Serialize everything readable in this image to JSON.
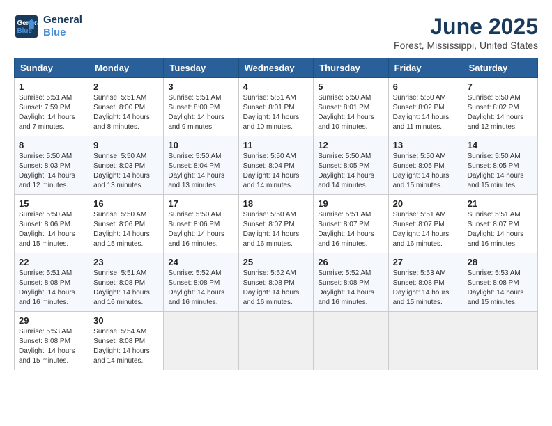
{
  "logo": {
    "line1": "General",
    "line2": "Blue"
  },
  "title": "June 2025",
  "location": "Forest, Mississippi, United States",
  "weekdays": [
    "Sunday",
    "Monday",
    "Tuesday",
    "Wednesday",
    "Thursday",
    "Friday",
    "Saturday"
  ],
  "weeks": [
    [
      {
        "day": "1",
        "sunrise": "5:51 AM",
        "sunset": "7:59 PM",
        "daylight": "14 hours and 7 minutes."
      },
      {
        "day": "2",
        "sunrise": "5:51 AM",
        "sunset": "8:00 PM",
        "daylight": "14 hours and 8 minutes."
      },
      {
        "day": "3",
        "sunrise": "5:51 AM",
        "sunset": "8:00 PM",
        "daylight": "14 hours and 9 minutes."
      },
      {
        "day": "4",
        "sunrise": "5:51 AM",
        "sunset": "8:01 PM",
        "daylight": "14 hours and 10 minutes."
      },
      {
        "day": "5",
        "sunrise": "5:50 AM",
        "sunset": "8:01 PM",
        "daylight": "14 hours and 10 minutes."
      },
      {
        "day": "6",
        "sunrise": "5:50 AM",
        "sunset": "8:02 PM",
        "daylight": "14 hours and 11 minutes."
      },
      {
        "day": "7",
        "sunrise": "5:50 AM",
        "sunset": "8:02 PM",
        "daylight": "14 hours and 12 minutes."
      }
    ],
    [
      {
        "day": "8",
        "sunrise": "5:50 AM",
        "sunset": "8:03 PM",
        "daylight": "14 hours and 12 minutes."
      },
      {
        "day": "9",
        "sunrise": "5:50 AM",
        "sunset": "8:03 PM",
        "daylight": "14 hours and 13 minutes."
      },
      {
        "day": "10",
        "sunrise": "5:50 AM",
        "sunset": "8:04 PM",
        "daylight": "14 hours and 13 minutes."
      },
      {
        "day": "11",
        "sunrise": "5:50 AM",
        "sunset": "8:04 PM",
        "daylight": "14 hours and 14 minutes."
      },
      {
        "day": "12",
        "sunrise": "5:50 AM",
        "sunset": "8:05 PM",
        "daylight": "14 hours and 14 minutes."
      },
      {
        "day": "13",
        "sunrise": "5:50 AM",
        "sunset": "8:05 PM",
        "daylight": "14 hours and 15 minutes."
      },
      {
        "day": "14",
        "sunrise": "5:50 AM",
        "sunset": "8:05 PM",
        "daylight": "14 hours and 15 minutes."
      }
    ],
    [
      {
        "day": "15",
        "sunrise": "5:50 AM",
        "sunset": "8:06 PM",
        "daylight": "14 hours and 15 minutes."
      },
      {
        "day": "16",
        "sunrise": "5:50 AM",
        "sunset": "8:06 PM",
        "daylight": "14 hours and 15 minutes."
      },
      {
        "day": "17",
        "sunrise": "5:50 AM",
        "sunset": "8:06 PM",
        "daylight": "14 hours and 16 minutes."
      },
      {
        "day": "18",
        "sunrise": "5:50 AM",
        "sunset": "8:07 PM",
        "daylight": "14 hours and 16 minutes."
      },
      {
        "day": "19",
        "sunrise": "5:51 AM",
        "sunset": "8:07 PM",
        "daylight": "14 hours and 16 minutes."
      },
      {
        "day": "20",
        "sunrise": "5:51 AM",
        "sunset": "8:07 PM",
        "daylight": "14 hours and 16 minutes."
      },
      {
        "day": "21",
        "sunrise": "5:51 AM",
        "sunset": "8:07 PM",
        "daylight": "14 hours and 16 minutes."
      }
    ],
    [
      {
        "day": "22",
        "sunrise": "5:51 AM",
        "sunset": "8:08 PM",
        "daylight": "14 hours and 16 minutes."
      },
      {
        "day": "23",
        "sunrise": "5:51 AM",
        "sunset": "8:08 PM",
        "daylight": "14 hours and 16 minutes."
      },
      {
        "day": "24",
        "sunrise": "5:52 AM",
        "sunset": "8:08 PM",
        "daylight": "14 hours and 16 minutes."
      },
      {
        "day": "25",
        "sunrise": "5:52 AM",
        "sunset": "8:08 PM",
        "daylight": "14 hours and 16 minutes."
      },
      {
        "day": "26",
        "sunrise": "5:52 AM",
        "sunset": "8:08 PM",
        "daylight": "14 hours and 16 minutes."
      },
      {
        "day": "27",
        "sunrise": "5:53 AM",
        "sunset": "8:08 PM",
        "daylight": "14 hours and 15 minutes."
      },
      {
        "day": "28",
        "sunrise": "5:53 AM",
        "sunset": "8:08 PM",
        "daylight": "14 hours and 15 minutes."
      }
    ],
    [
      {
        "day": "29",
        "sunrise": "5:53 AM",
        "sunset": "8:08 PM",
        "daylight": "14 hours and 15 minutes."
      },
      {
        "day": "30",
        "sunrise": "5:54 AM",
        "sunset": "8:08 PM",
        "daylight": "14 hours and 14 minutes."
      },
      null,
      null,
      null,
      null,
      null
    ]
  ],
  "labels": {
    "sunrise": "Sunrise:",
    "sunset": "Sunset:",
    "daylight": "Daylight hours"
  }
}
